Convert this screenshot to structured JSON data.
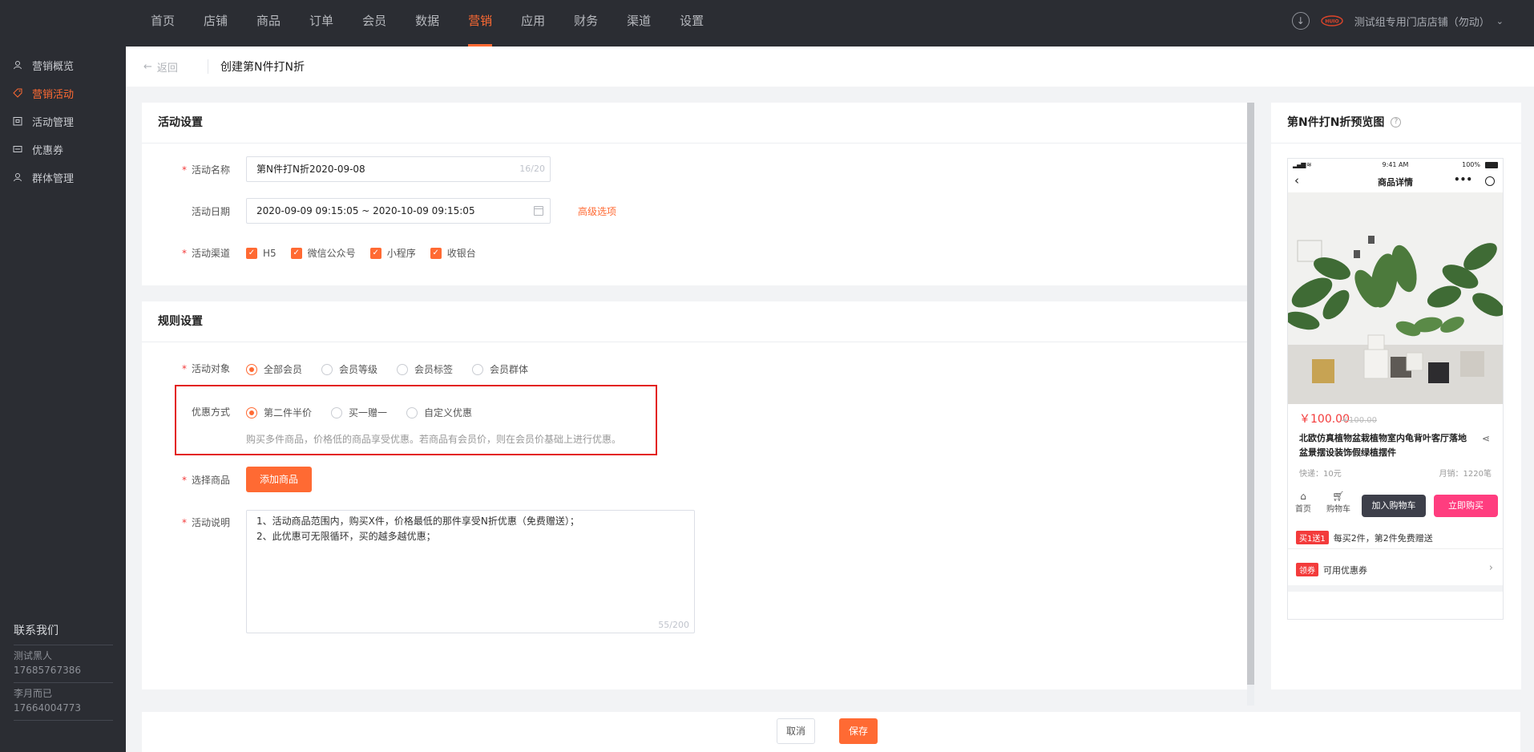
{
  "nav": {
    "items": [
      "首页",
      "店铺",
      "商品",
      "订单",
      "会员",
      "数据",
      "营销",
      "应用",
      "财务",
      "渠道",
      "设置"
    ],
    "active": 6,
    "store_name": "测试组专用门店店铺（勿动）",
    "brand_mark_text": "HUIO"
  },
  "sidebar": {
    "items": [
      {
        "label": "营销概览"
      },
      {
        "label": "营销活动"
      },
      {
        "label": "活动管理"
      },
      {
        "label": "优惠券"
      },
      {
        "label": "群体管理"
      }
    ],
    "active": 1,
    "contact_title": "联系我们",
    "contacts": [
      {
        "name": "测试黑人",
        "phone": "17685767386"
      },
      {
        "name": "李月而已",
        "phone": "17664004773"
      }
    ]
  },
  "header": {
    "back_label": "返回",
    "title": "创建第N件打N折"
  },
  "activity": {
    "section_title": "活动设置",
    "name_label": "活动名称",
    "name_value": "第N件打N折2020-09-08",
    "name_counter": "16/20",
    "date_label": "活动日期",
    "date_value": "2020-09-09 09:15:05 ~ 2020-10-09 09:15:05",
    "advanced_link": "高级选项",
    "channel_label": "活动渠道",
    "channels": [
      "H5",
      "微信公众号",
      "小程序",
      "收银台"
    ]
  },
  "rules": {
    "section_title": "规则设置",
    "target_label": "活动对象",
    "targets": [
      "全部会员",
      "会员等级",
      "会员标签",
      "会员群体"
    ],
    "target_selected": 0,
    "discount_label": "优惠方式",
    "discounts": [
      "第二件半价",
      "买一赠一",
      "自定义优惠"
    ],
    "discount_selected": 0,
    "discount_hint": "购买多件商品，价格低的商品享受优惠。若商品有会员价，则在会员价基础上进行优惠。",
    "goods_label": "选择商品",
    "add_goods_button": "添加商品",
    "desc_label": "活动说明",
    "desc_lines": [
      "1、活动商品范围内，购买X件，价格最低的那件享受N折优惠（免费赠送）；",
      "2、此优惠可无限循环，买的越多越优惠；"
    ],
    "desc_counter": "55/200"
  },
  "preview": {
    "title": "第N件打N折预览图",
    "help_icon": "?",
    "status_time": "9:41 AM",
    "status_battery": "100%",
    "page_title": "商品详情",
    "price": "￥100.00",
    "original_price": "￥100.00",
    "product_name": "北欧仿真植物盆栽植物室内龟背叶客厅落地盆景摆设装饰假绿植摆件",
    "shipping": "快递：10元",
    "sales": "月销：1220笔",
    "home_label": "首页",
    "cart_label": "购物车",
    "add_cart_button": "加入购物车",
    "buy_button": "立即购买",
    "promo_tag": "买1送1",
    "promo_text": "每买2件，第2件免费赠送",
    "coupon_tag": "领券",
    "coupon_text": "可用优惠券"
  },
  "footer": {
    "cancel_label": "取消",
    "save_label": "保存"
  },
  "colors": {
    "accent": "#ff6a33",
    "nav_bg": "#2b2d33",
    "highlight_border": "#e3201b",
    "buy_button": "#ff3d7f",
    "add_cart_button": "#3d3f4a"
  }
}
